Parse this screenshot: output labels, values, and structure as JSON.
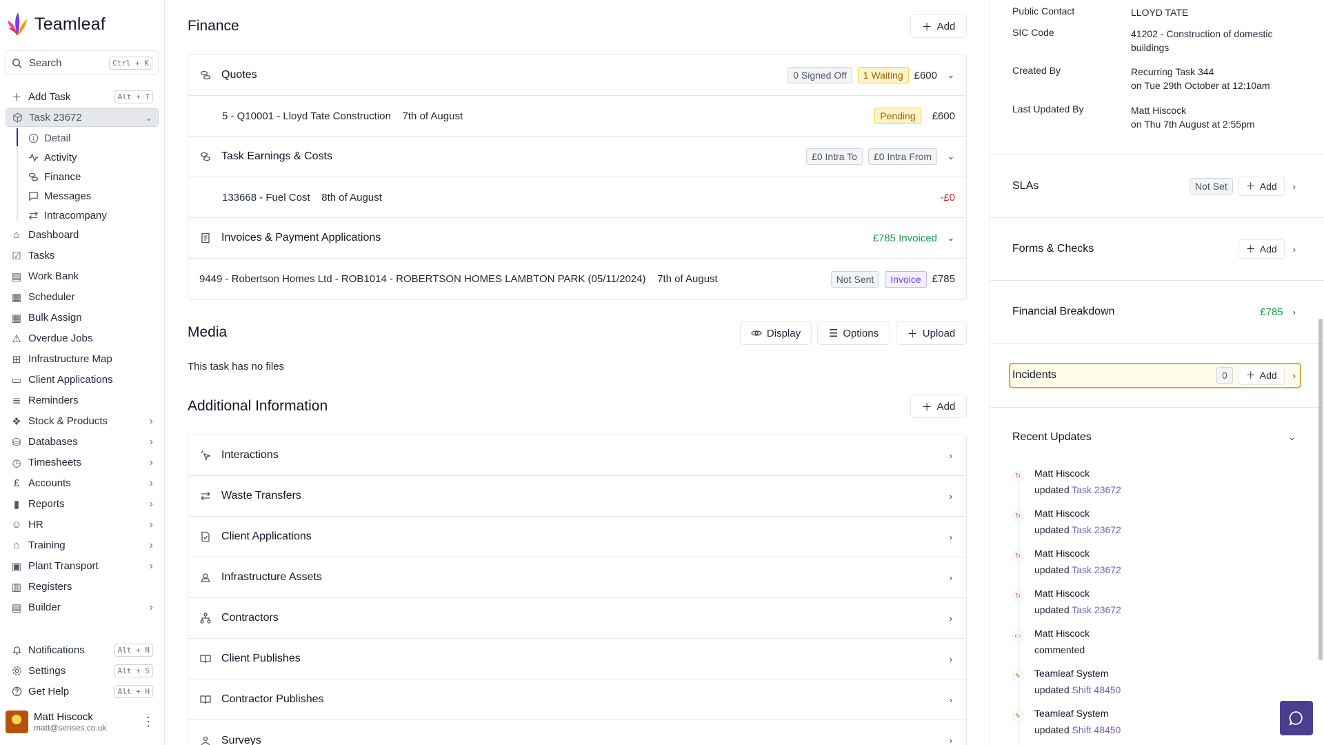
{
  "brand": {
    "name": "Teamleaf"
  },
  "search": {
    "label": "Search",
    "shortcut": "Ctrl + K"
  },
  "nav": {
    "add_task": {
      "label": "Add Task",
      "shortcut": "Alt + T"
    },
    "task": {
      "label": "Task 23672"
    },
    "task_sub": [
      "Detail",
      "Activity",
      "Finance",
      "Messages",
      "Intracompany"
    ],
    "items": [
      {
        "label": "Dashboard",
        "icon": "home-icon"
      },
      {
        "label": "Tasks",
        "icon": "tasks-icon"
      },
      {
        "label": "Work Bank",
        "icon": "bank-icon"
      },
      {
        "label": "Scheduler",
        "icon": "calendar-icon"
      },
      {
        "label": "Bulk Assign",
        "icon": "calendar-plus-icon"
      },
      {
        "label": "Overdue Jobs",
        "icon": "warning-icon"
      },
      {
        "label": "Infrastructure Map",
        "icon": "map-icon"
      },
      {
        "label": "Client Applications",
        "icon": "document-icon"
      },
      {
        "label": "Reminders",
        "icon": "list-icon"
      },
      {
        "label": "Stock & Products",
        "icon": "boxes-icon"
      },
      {
        "label": "Databases",
        "icon": "database-icon"
      },
      {
        "label": "Timesheets",
        "icon": "clock-icon"
      },
      {
        "label": "Accounts",
        "icon": "pound-icon"
      },
      {
        "label": "Reports",
        "icon": "bar-chart-icon"
      },
      {
        "label": "HR",
        "icon": "users-icon"
      },
      {
        "label": "Training",
        "icon": "graduation-icon"
      },
      {
        "label": "Plant Transport",
        "icon": "truck-icon"
      },
      {
        "label": "Registers",
        "icon": "book-icon"
      },
      {
        "label": "Builder",
        "icon": "builder-icon"
      }
    ],
    "notifications": {
      "label": "Notifications",
      "shortcut": "Alt + N"
    },
    "settings": {
      "label": "Settings",
      "shortcut": "Alt + S"
    },
    "help": {
      "label": "Get Help",
      "shortcut": "Alt + H"
    }
  },
  "user": {
    "name": "Matt Hiscock",
    "email": "matt@senses.co.uk"
  },
  "finance": {
    "title": "Finance",
    "add": "Add",
    "quotes": {
      "title": "Quotes",
      "signed_off": "0 Signed Off",
      "waiting": "1 Waiting",
      "total": "£600"
    },
    "quote_item": {
      "text": "5 - Q10001 - Lloyd Tate Construction",
      "date": "7th of August",
      "status": "Pending",
      "amount": "£600"
    },
    "earnings": {
      "title": "Task Earnings & Costs",
      "intra_to": "£0 Intra To",
      "intra_from": "£0 Intra From"
    },
    "earning_item": {
      "text": "133668 - Fuel Cost",
      "date": "8th of August",
      "amount": "-£0"
    },
    "invoices": {
      "title": "Invoices & Payment Applications",
      "total": "£785 Invoiced"
    },
    "invoice_item": {
      "text": "9449 - Robertson Homes Ltd - ROB1014 - ROBERTSON HOMES LAMBTON PARK (05/11/2024)",
      "date": "7th of August",
      "status": "Not Sent",
      "type": "Invoice",
      "amount": "£785"
    }
  },
  "media": {
    "title": "Media",
    "display": "Display",
    "options": "Options",
    "upload": "Upload",
    "empty": "This task has no files"
  },
  "additional": {
    "title": "Additional Information",
    "add": "Add",
    "rows": [
      "Interactions",
      "Waste Transfers",
      "Client Applications",
      "Infrastructure Assets",
      "Contractors",
      "Client Publishes",
      "Contractor Publishes",
      "Surveys"
    ]
  },
  "details": {
    "public_contact": {
      "k": "Public Contact",
      "v": "LLOYD TATE"
    },
    "sic": {
      "k": "SIC Code",
      "v": "41202 - Construction of domestic buildings"
    },
    "created": {
      "k": "Created By",
      "v1": "Recurring Task 344",
      "v2": "on Tue 29th October at 12:10am"
    },
    "updated": {
      "k": "Last Updated By",
      "v1": "Matt Hiscock",
      "v2": "on Thu 7th August at 2:55pm"
    }
  },
  "slas": {
    "title": "SLAs",
    "status": "Not Set",
    "add": "Add"
  },
  "forms": {
    "title": "Forms & Checks",
    "add": "Add"
  },
  "financial_breakdown": {
    "title": "Financial Breakdown",
    "amount": "£785"
  },
  "incidents": {
    "title": "Incidents",
    "count": "0",
    "add": "Add"
  },
  "recent": {
    "title": "Recent Updates",
    "items": [
      {
        "name": "Matt Hiscock",
        "action": "updated",
        "link": "Task 23672",
        "icon": "refresh-icon"
      },
      {
        "name": "Matt Hiscock",
        "action": "updated",
        "link": "Task 23672",
        "icon": "refresh-icon"
      },
      {
        "name": "Matt Hiscock",
        "action": "updated",
        "link": "Task 23672",
        "icon": "refresh-icon"
      },
      {
        "name": "Matt Hiscock",
        "action": "updated",
        "link": "Task 23672",
        "icon": "refresh-icon"
      },
      {
        "name": "Matt Hiscock",
        "action": "commented",
        "link": "",
        "icon": "comment-icon"
      },
      {
        "name": "Teamleaf System",
        "action": "updated",
        "link": "Shift 48450",
        "icon": "pencil-icon"
      },
      {
        "name": "Teamleaf System",
        "action": "updated",
        "link": "Shift 48450",
        "icon": "pencil-icon"
      }
    ]
  },
  "colors": {
    "accent": "#4c3d8f",
    "incident_border": "#e0a446",
    "link": "#7c5fbd",
    "green": "#16a34a",
    "red": "#dc2626"
  }
}
